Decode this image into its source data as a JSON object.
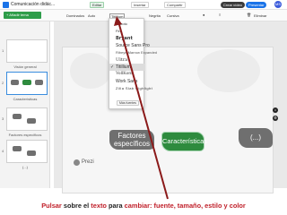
{
  "app": {
    "title": "Comunicación didác..."
  },
  "header": {
    "edit_tab": "Editar",
    "insert_tab": "Insertar",
    "share_tab": "Compartir",
    "create_video": "Crear vídeo",
    "present": "Presentar",
    "avatar": "MS"
  },
  "toolbar": {
    "zoom": "Dominados",
    "size": "Auto",
    "font": "Titillium",
    "bold": "Negrita",
    "cursiva": "Cursiva",
    "delete": "Eliminar"
  },
  "sidebar": {
    "add_button": "+ Añadir tema",
    "slides": [
      {
        "num": "1",
        "caption": "Visión general"
      },
      {
        "num": "2",
        "caption": "Características"
      },
      {
        "num": "3",
        "caption": "Factores específicos"
      },
      {
        "num": "4",
        "caption": "(...)"
      }
    ]
  },
  "font_menu": {
    "items": [
      "Roboto",
      "Fira",
      "Bryant",
      "Source Sans Pro",
      "Ribeye Marrow Expanded",
      "Ultra",
      "Titillium",
      "VollKorn",
      "Work Sans",
      "Zilla Slab Highlight"
    ],
    "selected": "Titillium",
    "more_button": "Más fuentes"
  },
  "canvas": {
    "topics": [
      {
        "label": "Factores específicos"
      },
      {
        "label": "Características"
      },
      {
        "label": "(...)"
      }
    ],
    "brand": "Prezi"
  },
  "caption": {
    "part1": "Pulsar",
    "part2": " sobre el ",
    "part3": "texto",
    "part4": " para ",
    "part5": "cambiar: fuente, tamaño, estilo y color"
  },
  "colors": {
    "accent_green": "#2e8b3e",
    "arrow_red": "#8b1a1a",
    "caption_red": "#c0202a"
  }
}
